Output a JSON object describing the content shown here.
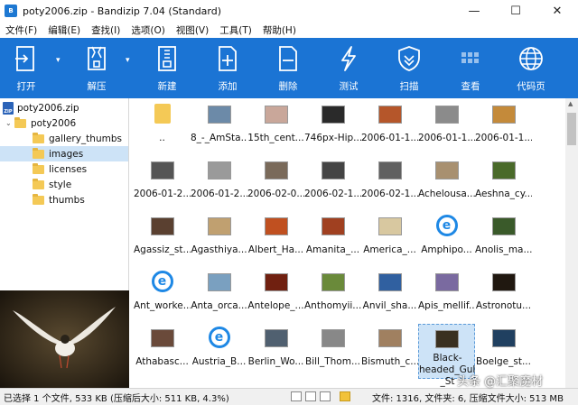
{
  "window": {
    "title": "poty2006.zip - Bandizip 7.04 (Standard)",
    "controls": [
      "—",
      "☐",
      "✕"
    ]
  },
  "menu": [
    "文件(F)",
    "编辑(E)",
    "查找(I)",
    "选项(O)",
    "视图(V)",
    "工具(T)",
    "帮助(H)"
  ],
  "toolbar": {
    "open": "打开",
    "extract": "解压",
    "new": "新建",
    "add": "添加",
    "delete": "删除",
    "test": "测试",
    "scan": "扫描",
    "view": "查看",
    "codepage": "代码页"
  },
  "tree": {
    "root": "poty2006.zip",
    "folder": "poty2006",
    "children": [
      "gallery_thumbs",
      "images",
      "licenses",
      "style",
      "thumbs"
    ],
    "selected": "images"
  },
  "files": [
    {
      "name": "..",
      "color": "#f4c956",
      "kind": "folder"
    },
    {
      "name": "8_-_AmSta...",
      "color": "#6c8aa8"
    },
    {
      "name": "15th_cent...",
      "color": "#c9a79a"
    },
    {
      "name": "746px-Hip...",
      "color": "#2a2a2a"
    },
    {
      "name": "2006-01-1...",
      "color": "#b5562a"
    },
    {
      "name": "2006-01-1...",
      "color": "#8b8b8b"
    },
    {
      "name": "2006-01-1...",
      "color": "#c48a3a"
    },
    {
      "name": "2006-01-2...",
      "color": "#555555"
    },
    {
      "name": "2006-01-2...",
      "color": "#9a9a9a"
    },
    {
      "name": "2006-02-0...",
      "color": "#7a6a5a"
    },
    {
      "name": "2006-02-1...",
      "color": "#444444"
    },
    {
      "name": "2006-02-1...",
      "color": "#606060"
    },
    {
      "name": "Achelousa...",
      "color": "#a89070"
    },
    {
      "name": "Aeshna_cy...",
      "color": "#4a6a2a"
    },
    {
      "name": "Agassiz_st...",
      "color": "#5a4030"
    },
    {
      "name": "Agasthiya...",
      "color": "#c0a070"
    },
    {
      "name": "Albert_Ha...",
      "color": "#c05020"
    },
    {
      "name": "Amanita_...",
      "color": "#a04020"
    },
    {
      "name": "America_...",
      "color": "#d8c8a0"
    },
    {
      "name": "Amphipo...",
      "color": "#1e88e5",
      "kind": "ie"
    },
    {
      "name": "Anolis_ma...",
      "color": "#3a5a2a"
    },
    {
      "name": "Ant_worke...",
      "color": "#1e88e5",
      "kind": "ie"
    },
    {
      "name": "Anta_orca...",
      "color": "#7aa0c0"
    },
    {
      "name": "Antelope_...",
      "color": "#702010"
    },
    {
      "name": "Anthomyii...",
      "color": "#6a8a3a"
    },
    {
      "name": "Anvil_sha...",
      "color": "#3060a0"
    },
    {
      "name": "Apis_mellif...",
      "color": "#7a6aa0"
    },
    {
      "name": "Astronotu...",
      "color": "#201810"
    },
    {
      "name": "Athabasc...",
      "color": "#6a4a3a"
    },
    {
      "name": "Austria_B...",
      "color": "#1e88e5",
      "kind": "ie"
    },
    {
      "name": "Berlin_Wo...",
      "color": "#506070"
    },
    {
      "name": "Bill_Thom...",
      "color": "#888888"
    },
    {
      "name": "Bismuth_c...",
      "color": "#a08060"
    },
    {
      "name": "Black-headed_Gull_-_St",
      "color": "#3a3020",
      "selected": true
    },
    {
      "name": "Boelge_st...",
      "color": "#204060"
    }
  ],
  "status": {
    "left": "已选择 1 个文件, 533 KB (压缩后大小: 511 KB, 4.3%)",
    "right": "文件: 1316, 文件夹: 6, 压缩文件大小: 513 MB"
  },
  "watermark": "头条 @汇聚魔材"
}
